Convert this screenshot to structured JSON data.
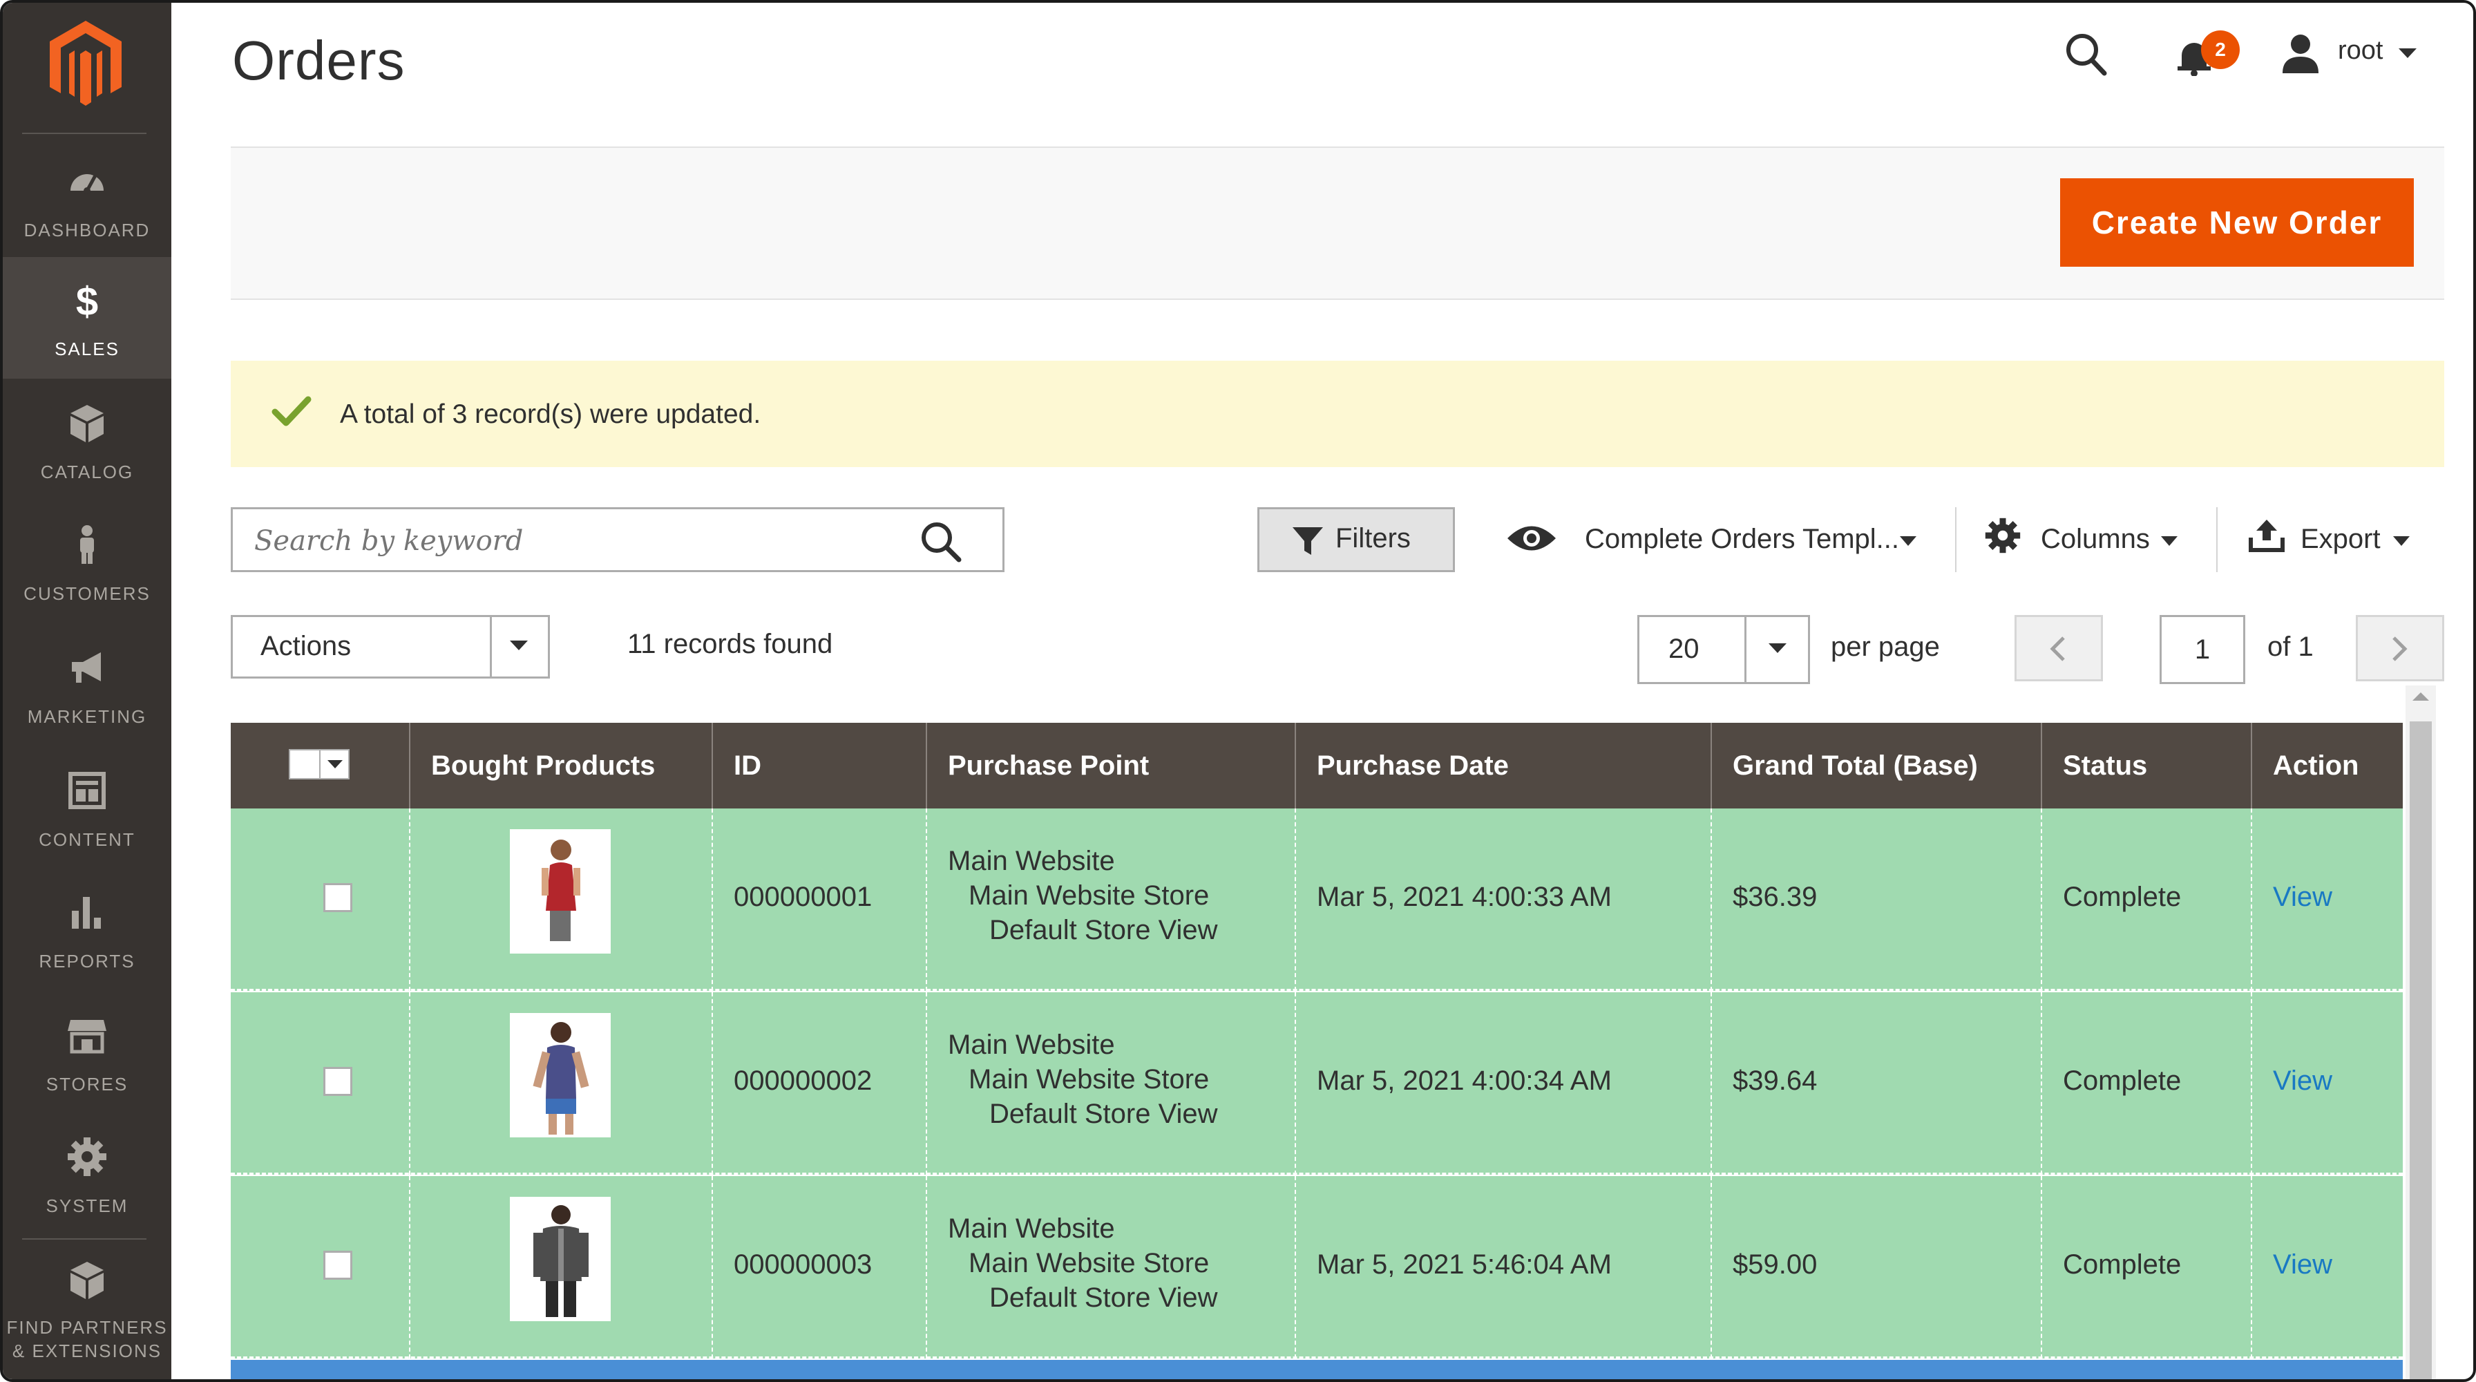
{
  "sidebar": {
    "items": [
      {
        "label": "DASHBOARD",
        "icon": "dashboard-icon"
      },
      {
        "label": "SALES",
        "icon": "dollar-icon",
        "active": true
      },
      {
        "label": "CATALOG",
        "icon": "box-icon"
      },
      {
        "label": "CUSTOMERS",
        "icon": "person-icon"
      },
      {
        "label": "MARKETING",
        "icon": "megaphone-icon"
      },
      {
        "label": "CONTENT",
        "icon": "content-icon"
      },
      {
        "label": "REPORTS",
        "icon": "bar-chart-icon"
      },
      {
        "label": "STORES",
        "icon": "storefront-icon"
      },
      {
        "label": "SYSTEM",
        "icon": "gear-icon"
      }
    ],
    "partners_line1": "FIND PARTNERS",
    "partners_line2": "& EXTENSIONS"
  },
  "header": {
    "title": "Orders",
    "notifications_count": "2",
    "user": "root"
  },
  "action_bar": {
    "create_label": "Create New Order"
  },
  "message": {
    "text": "A total of 3 record(s) were updated."
  },
  "toolbar": {
    "search_placeholder": "Search by keyword",
    "filters_label": "Filters",
    "view_label": "Complete Orders Templ...",
    "columns_label": "Columns",
    "export_label": "Export",
    "actions_label": "Actions",
    "records_found": "11 records found",
    "per_page_value": "20",
    "per_page_label": "per page",
    "page_value": "1",
    "page_of": "of 1"
  },
  "grid": {
    "columns": [
      "Bought Products",
      "ID",
      "Purchase Point",
      "Purchase Date",
      "Grand Total (Base)",
      "Status",
      "Action"
    ],
    "rows": [
      {
        "id": "000000001",
        "pp1": "Main Website",
        "pp2": "Main Website Store",
        "pp3": "Default Store View",
        "date": "Mar 5, 2021 4:00:33 AM",
        "total": "$36.39",
        "status": "Complete",
        "action": "View"
      },
      {
        "id": "000000002",
        "pp1": "Main Website",
        "pp2": "Main Website Store",
        "pp3": "Default Store View",
        "date": "Mar 5, 2021 4:00:34 AM",
        "total": "$39.64",
        "status": "Complete",
        "action": "View"
      },
      {
        "id": "000000003",
        "pp1": "Main Website",
        "pp2": "Main Website Store",
        "pp3": "Default Store View",
        "date": "Mar 5, 2021 5:46:04 AM",
        "total": "$59.00",
        "status": "Complete",
        "action": "View"
      }
    ]
  },
  "colors": {
    "sidebar": "#373330",
    "accent": "#eb5202",
    "row_highlight": "#a0dab0",
    "header_bg": "#514943",
    "message_bg": "#fdf8d3",
    "link": "#1979c3"
  }
}
